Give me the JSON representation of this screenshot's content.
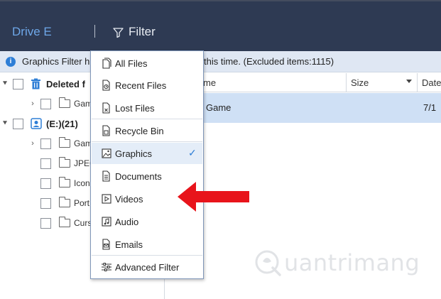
{
  "header": {
    "drive_label": "Drive E",
    "filter_label": "Filter"
  },
  "infobar": {
    "left_text": "Graphics Filter h",
    "right_text": "this time. (Excluded items:1115)"
  },
  "tree": {
    "items": [
      {
        "label": "Deleted f",
        "bold": true,
        "expanded": true,
        "icon": "trash-icon"
      },
      {
        "label": "Gam",
        "bold": false,
        "expanded": false,
        "icon": "folder-icon"
      },
      {
        "label": "(E:)(21)",
        "bold": true,
        "expanded": true,
        "icon": "drive-user-icon"
      },
      {
        "label": "Gam",
        "bold": false,
        "expanded": false,
        "icon": "folder-icon"
      },
      {
        "label": "JPEG",
        "bold": false,
        "icon": "folder-icon"
      },
      {
        "label": "Icon",
        "bold": false,
        "icon": "folder-icon"
      },
      {
        "label": "Port",
        "bold": false,
        "icon": "folder-icon"
      },
      {
        "label": "Curs",
        "bold": false,
        "icon": "folder-icon"
      }
    ]
  },
  "table": {
    "columns": [
      "me",
      "Size",
      "Date"
    ],
    "rows": [
      {
        "name": "Game",
        "size": "",
        "date": "7/1"
      }
    ]
  },
  "filter_menu": {
    "items": [
      {
        "label": "All Files",
        "icon": "all-files-icon"
      },
      {
        "label": "Recent Files",
        "icon": "recent-files-icon"
      },
      {
        "label": "Lost Files",
        "icon": "lost-files-icon"
      },
      {
        "label": "Recycle Bin",
        "icon": "recycle-bin-icon"
      },
      {
        "label": "Graphics",
        "icon": "graphics-icon",
        "selected": true
      },
      {
        "label": "Documents",
        "icon": "documents-icon"
      },
      {
        "label": "Videos",
        "icon": "videos-icon"
      },
      {
        "label": "Audio",
        "icon": "audio-icon"
      },
      {
        "label": "Emails",
        "icon": "emails-icon"
      },
      {
        "label": "Advanced Filter",
        "icon": "advanced-filter-icon"
      }
    ],
    "check_glyph": "✓"
  },
  "watermark": {
    "text": "uantrimang"
  },
  "colors": {
    "topbar": "#2e3a53",
    "accent": "#2e7ed6",
    "drive_label": "#6ea7e8",
    "selected_row": "#cfe0f5",
    "arrow": "#e8141b"
  }
}
